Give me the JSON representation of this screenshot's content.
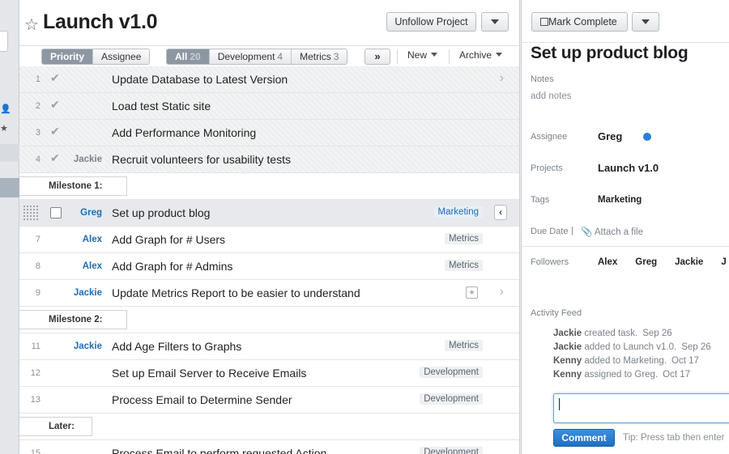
{
  "left_strip": {
    "icons": [
      "person-icon",
      "star-icon"
    ]
  },
  "project": {
    "title": "Launch  v1.0",
    "unfollow_label": "Unfollow Project"
  },
  "toolbar": {
    "sort_segments": [
      {
        "label": "Priority",
        "active": true
      },
      {
        "label": "Assignee",
        "active": false
      }
    ],
    "filter_tabs": [
      {
        "label": "All",
        "count": "20",
        "active": true
      },
      {
        "label": "Development",
        "count": "4",
        "active": false
      },
      {
        "label": "Metrics",
        "count": "3",
        "active": false
      }
    ],
    "more_label": "»",
    "new_label": "New",
    "archive_label": "Archive"
  },
  "tasks": [
    {
      "kind": "task",
      "num": "1",
      "done": true,
      "assignee": "",
      "name": "Update Database to Latest Version",
      "tag": "",
      "chevron": true
    },
    {
      "kind": "task",
      "num": "2",
      "done": true,
      "assignee": "",
      "name": "Load test Static site",
      "tag": ""
    },
    {
      "kind": "task",
      "num": "3",
      "done": true,
      "assignee": "",
      "name": "Add Performance Monitoring",
      "tag": ""
    },
    {
      "kind": "task",
      "num": "4",
      "done": true,
      "assignee": "Jackie",
      "name": "Recruit volunteers for usability tests",
      "tag": ""
    },
    {
      "kind": "milestone",
      "label": "Milestone 1:"
    },
    {
      "kind": "task",
      "num": "",
      "selected": true,
      "assignee": "Greg",
      "name": "Set up product blog",
      "tag": "Marketing"
    },
    {
      "kind": "task",
      "num": "7",
      "assignee": "Alex",
      "name": "Add Graph for # Users",
      "tag": "Metrics"
    },
    {
      "kind": "task",
      "num": "8",
      "assignee": "Alex",
      "name": "Add Graph for # Admins",
      "tag": "Metrics"
    },
    {
      "kind": "task",
      "num": "9",
      "assignee": "Jackie",
      "name": "Update Metrics Report to be easier to understand",
      "tag": "",
      "calendar": true,
      "chevron": true
    },
    {
      "kind": "milestone",
      "label": "Milestone 2:"
    },
    {
      "kind": "task",
      "num": "11",
      "assignee": "Jackie",
      "name": "Add Age Filters to Graphs",
      "tag": "Metrics"
    },
    {
      "kind": "task",
      "num": "12",
      "assignee": "",
      "name": "Set up Email Server to Receive Emails",
      "tag": "Development"
    },
    {
      "kind": "task",
      "num": "13",
      "assignee": "",
      "name": "Process Email to Determine Sender",
      "tag": "Development"
    },
    {
      "kind": "milestone",
      "label": "Later:"
    },
    {
      "kind": "task",
      "num": "15",
      "assignee": "",
      "name": "Process Email to perform requested Action",
      "tag": "Development"
    }
  ],
  "detail": {
    "mark_complete_label": "Mark Complete",
    "title": "Set up product blog",
    "notes_label": "Notes",
    "notes_placeholder": "add notes",
    "assignee_label": "Assignee",
    "assignee": "Greg",
    "projects_label": "Projects",
    "project": "Launch v1.0",
    "tags_label": "Tags",
    "tag": "Marketing",
    "due_label": "Due Date",
    "due_sep": "|",
    "attach_label": "Attach a file",
    "followers_label": "Followers",
    "followers": [
      "Alex",
      "Greg",
      "Jackie",
      "J"
    ],
    "activity_label": "Activity Feed",
    "activity": [
      {
        "who": "Jackie",
        "what": "created task.",
        "when": "Sep 26"
      },
      {
        "who": "Jackie",
        "what": "added to Launch  v1.0.",
        "when": "Sep 26"
      },
      {
        "who": "Kenny",
        "what": "added to Marketing.",
        "when": "Oct 17"
      },
      {
        "who": "Kenny",
        "what": "assigned to Greg.",
        "when": "Oct 17"
      }
    ],
    "comment_label": "Comment",
    "tip": "Tip: Press tab then enter"
  }
}
